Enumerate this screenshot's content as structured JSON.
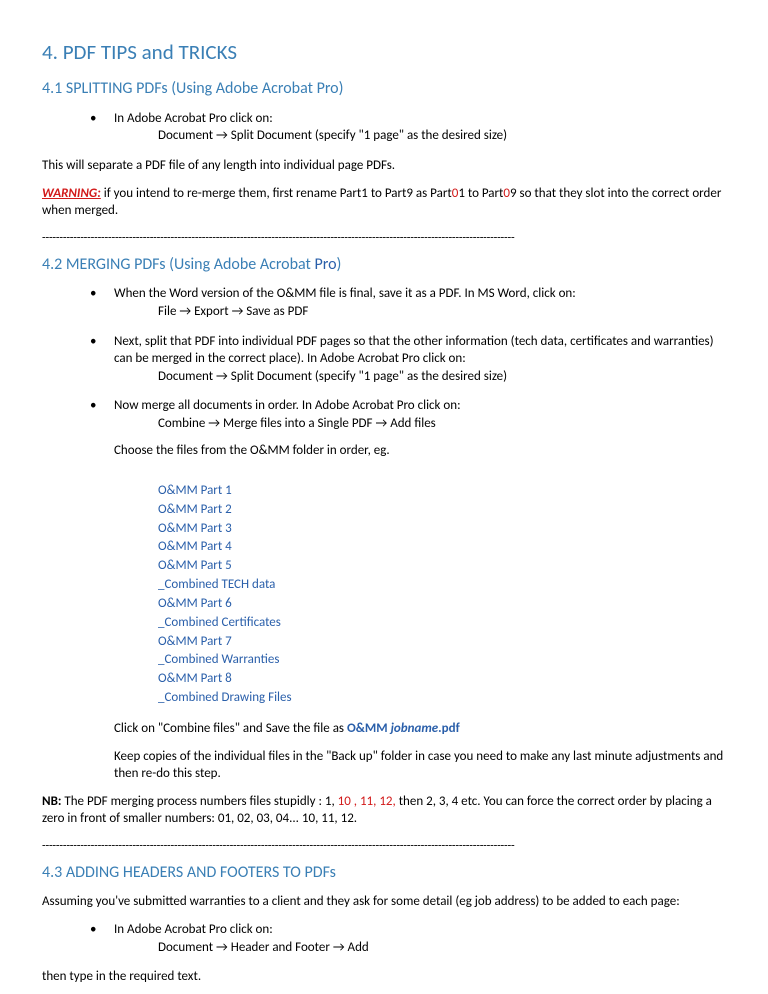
{
  "title": "4. PDF TIPS and TRICKS",
  "s41": {
    "heading": "4.1 SPLITTING PDFs (Using Adobe Acrobat Pro)",
    "b1_line1": "In Adobe Acrobat Pro click on:",
    "b1_line2_a": "Document ",
    "b1_line2_b": " Split Document (specify \"1 page\" as the desired size)",
    "p1": "This will separate a PDF file of any length into individual page PDFs.",
    "warn_label": "WARNING:",
    "warn_a": " if you intend to re-merge them, first rename Part1 to Part9 as Part",
    "warn_0a": "0",
    "warn_b": "1 to Part",
    "warn_0b": "0",
    "warn_c": "9 so that they slot into the correct order when merged."
  },
  "s42": {
    "heading_a": "4.2 MERGING PDFs (Using Adobe Acrobat ",
    "heading_pro": "Pro",
    "heading_b": ")",
    "b1_line1": "When the Word version of the O&MM file is final, save it as a PDF. In MS Word, click on:",
    "b1_line2_a": "File ",
    "b1_line2_b": " Export ",
    "b1_line2_c": " Save as PDF",
    "b2_line1": "Next, split that PDF into individual PDF pages so that the other information (tech data, certificates and warranties) can be merged in the correct place). In Adobe Acrobat Pro click on:",
    "b2_line2_a": "Document ",
    "b2_line2_b": " Split Document (specify \"1 page\" as the desired size)",
    "b3_line1": "Now merge all documents in order. In Adobe Acrobat Pro click on:",
    "b3_line2_a": "Combine ",
    "b3_line2_b": " Merge files into a Single PDF ",
    "b3_line2_c": " Add files",
    "b3_p2": "Choose the files from the O&MM folder in order, eg.",
    "files": [
      "O&MM Part 1",
      "O&MM Part 2",
      "O&MM Part 3",
      "O&MM Part 4",
      "O&MM Part 5",
      "_Combined TECH data",
      "O&MM Part 6",
      "_Combined Certificates",
      "O&MM Part 7",
      "_Combined Warranties",
      "O&MM Part 8",
      "_Combined Drawing Files"
    ],
    "b3_p3_a": "Click on \"Combine files\" and Save the file as ",
    "b3_p3_b": "O&MM ",
    "b3_p3_c": "jobname",
    "b3_p3_d": ".pdf",
    "b3_p4": "Keep copies of the individual files in the \"Back up\" folder in case you need to make any last  minute adjustments and then re-do this step.",
    "nb_label": "NB:",
    "nb_a": " The PDF merging process numbers files stupidly : 1, ",
    "nb_red": "10 , 11, 12,",
    "nb_b": " then 2, 3, 4 etc. You can force the correct order by placing a zero in front of smaller numbers: 01, 02, 03, 04... 10, 11, 12."
  },
  "s43": {
    "heading": "4.3 ADDING HEADERS AND FOOTERS TO PDFs",
    "p1": "Assuming you've submitted warranties to a client and they ask for some detail (eg job address) to be added to each page:",
    "b1_line1": "In Adobe Acrobat Pro click on:",
    "b1_line2_a": "Document ",
    "b1_line2_b": " Header and Footer ",
    "b1_line2_c": " Add",
    "p2": "then type in the required text."
  },
  "dash": "----------------------------------------------------------------------------------------------------------------------------------------",
  "arrow": "→"
}
